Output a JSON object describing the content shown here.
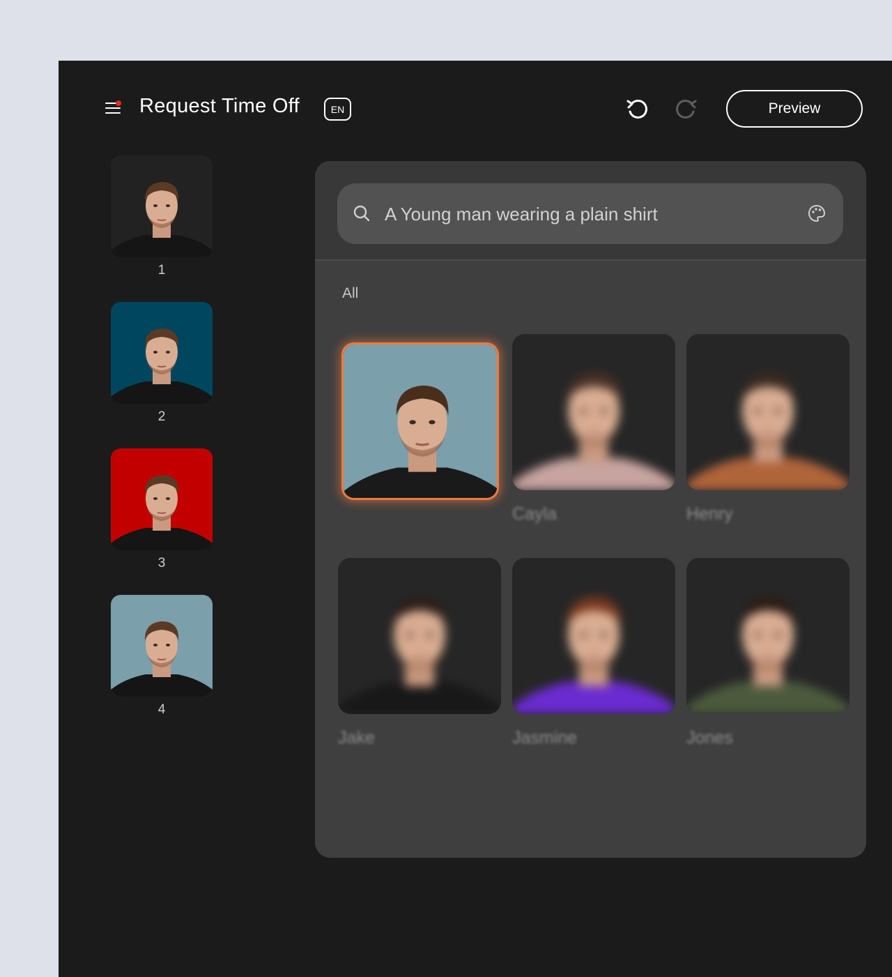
{
  "header": {
    "title": "Request Time Off",
    "language": "EN",
    "preview_label": "Preview"
  },
  "variants": [
    {
      "label": "1",
      "background": "#222222"
    },
    {
      "label": "2",
      "background": "#00465f"
    },
    {
      "label": "3",
      "background": "#c20000"
    },
    {
      "label": "4",
      "background": "#7b9fab"
    }
  ],
  "search": {
    "value": "A Young man wearing a plain shirt",
    "placeholder": ""
  },
  "filter": {
    "label": "All"
  },
  "avatars": [
    {
      "name": "",
      "selected": true,
      "background": "#7b9fab",
      "shirt": "#1a1a1a"
    },
    {
      "name": "Cayla",
      "selected": false,
      "background": "#262626",
      "shirt": "#c7a4a0"
    },
    {
      "name": "Henry",
      "selected": false,
      "background": "#262626",
      "shirt": "#b0643a"
    },
    {
      "name": "Jake",
      "selected": false,
      "background": "#262626",
      "shirt": "#181818"
    },
    {
      "name": "Jasmine",
      "selected": false,
      "background": "#262626",
      "shirt": "#6a2bd0"
    },
    {
      "name": "Jones",
      "selected": false,
      "background": "#262626",
      "shirt": "#4b5a3c"
    }
  ],
  "colors": {
    "accent": "#f07a3e",
    "notification": "#e42b22",
    "app_background": "#1b1b1b",
    "panel_background": "#3f3f3f"
  }
}
